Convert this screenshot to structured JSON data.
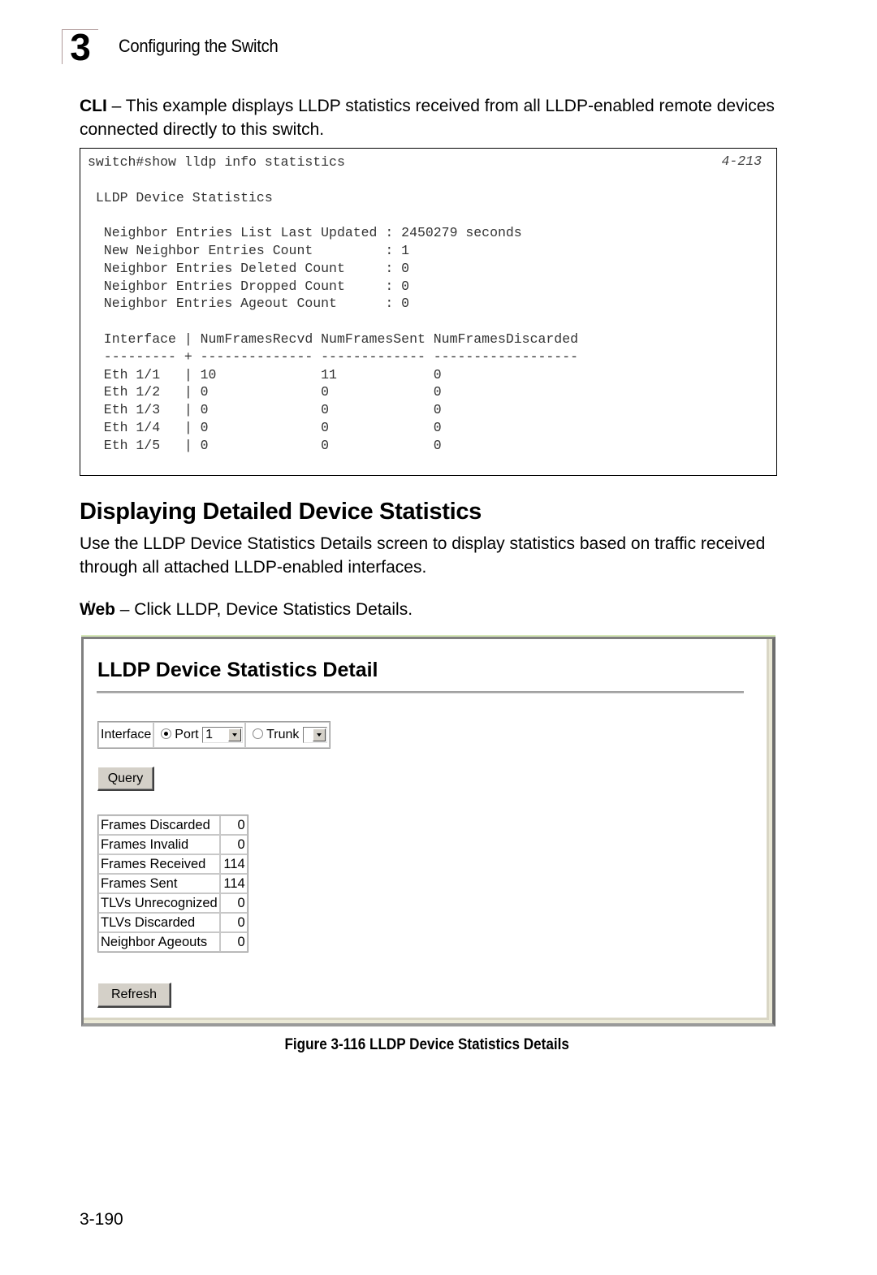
{
  "header": {
    "chapter_number": "3",
    "chapter_title": "Configuring the Switch"
  },
  "intro": {
    "label": "CLI",
    "text": " – This example displays LLDP statistics received from all LLDP-enabled remote devices connected directly to this switch."
  },
  "cli": {
    "command": "switch#show lldp info statistics",
    "reference": "4-213",
    "section_title": "LLDP Device Statistics",
    "summary": [
      {
        "label": "Neighbor Entries List Last Updated",
        "value": "2450279 seconds"
      },
      {
        "label": "New Neighbor Entries Count",
        "value": "1"
      },
      {
        "label": "Neighbor Entries Deleted Count",
        "value": "0"
      },
      {
        "label": "Neighbor Entries Dropped Count",
        "value": "0"
      },
      {
        "label": "Neighbor Entries Ageout Count",
        "value": "0"
      }
    ],
    "table_headers": [
      "Interface",
      "NumFramesRecvd",
      "NumFramesSent",
      "NumFramesDiscarded"
    ],
    "table_rows": [
      [
        "Eth 1/1",
        "10",
        "11",
        "0"
      ],
      [
        "Eth 1/2",
        "0",
        "0",
        "0"
      ],
      [
        "Eth 1/3",
        "0",
        "0",
        "0"
      ],
      [
        "Eth 1/4",
        "0",
        "0",
        "0"
      ],
      [
        "Eth 1/5",
        "0",
        "0",
        "0"
      ]
    ],
    "continuation": "⋮"
  },
  "section": {
    "heading": "Displaying Detailed Device Statistics",
    "description": "Use the LLDP Device Statistics Details screen to display statistics based on traffic received through all attached LLDP-enabled interfaces.",
    "web_label": "Web",
    "web_text": " – Click LLDP, Device Statistics Details."
  },
  "web": {
    "title": "LLDP Device Statistics Detail",
    "interface_label": "Interface",
    "port_label": "Port",
    "port_value": "1",
    "port_selected": true,
    "trunk_label": "Trunk",
    "trunk_value": "",
    "query_button": "Query",
    "refresh_button": "Refresh",
    "stats": [
      {
        "label": "Frames Discarded",
        "value": "0"
      },
      {
        "label": "Frames Invalid",
        "value": "0"
      },
      {
        "label": "Frames Received",
        "value": "114"
      },
      {
        "label": "Frames Sent",
        "value": "114"
      },
      {
        "label": "TLVs Unrecognized",
        "value": "0"
      },
      {
        "label": "TLVs Discarded",
        "value": "0"
      },
      {
        "label": "Neighbor Ageouts",
        "value": "0"
      }
    ]
  },
  "figure": {
    "caption": "Figure 3-116  LLDP Device Statistics Details"
  },
  "footer": {
    "page_number": "3-190"
  }
}
